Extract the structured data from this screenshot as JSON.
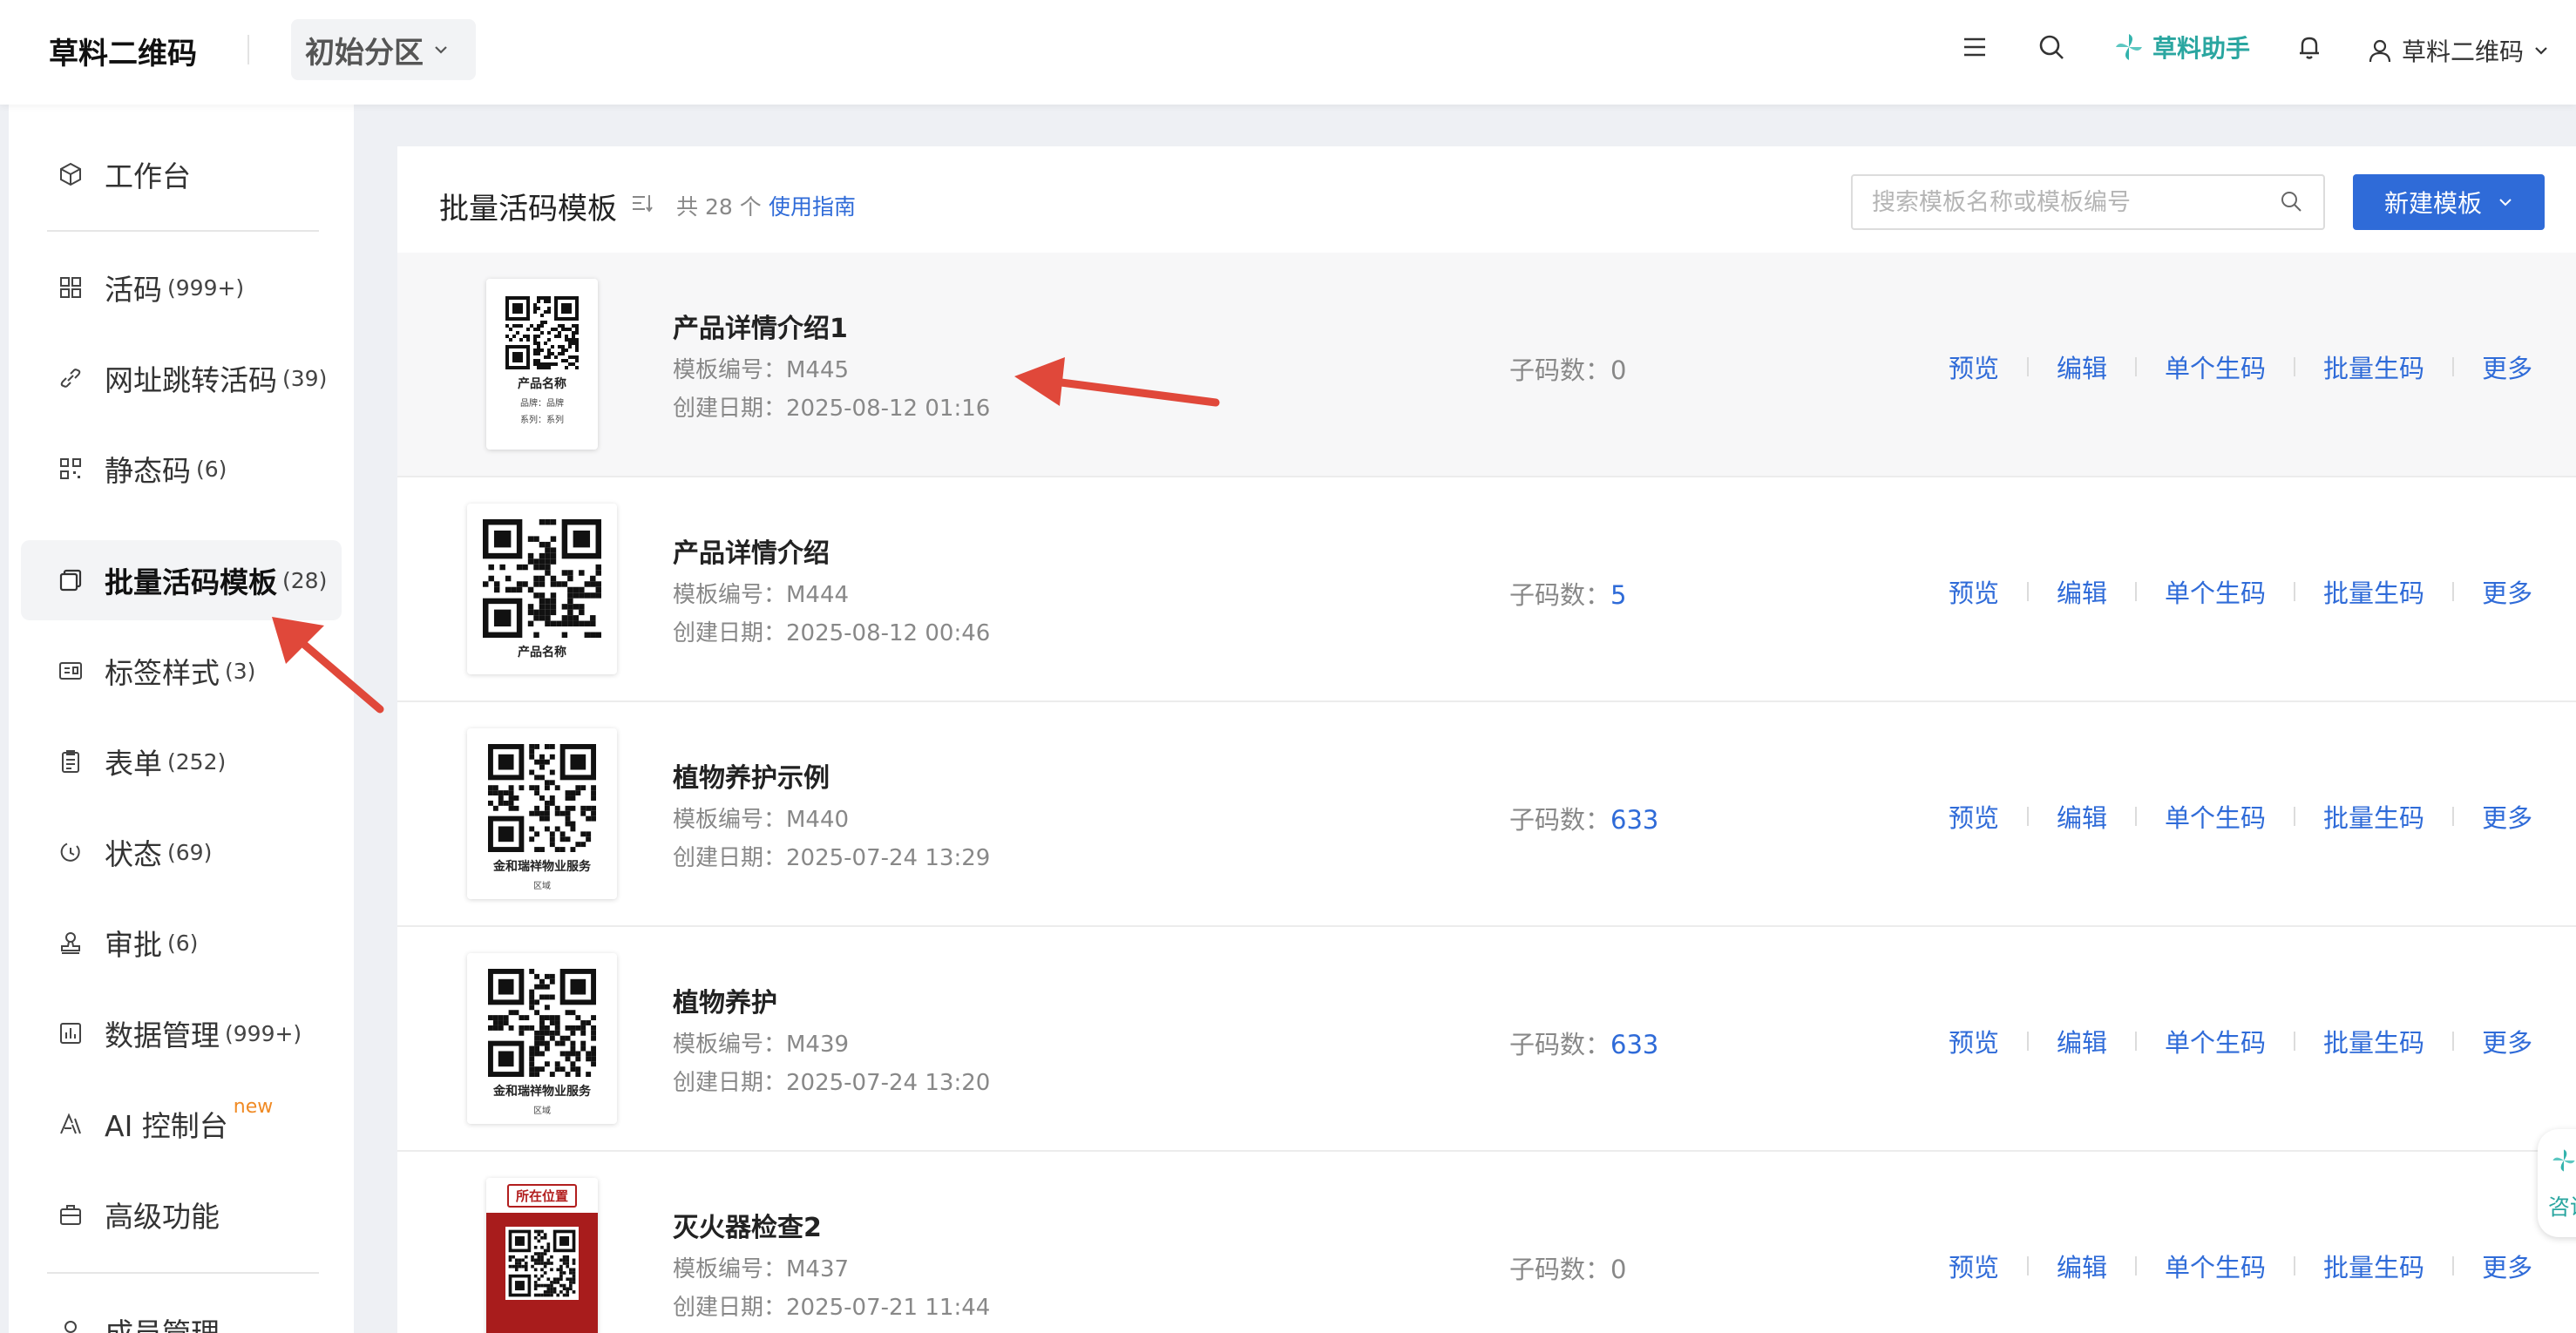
{
  "header": {
    "brand": "草料二维码",
    "zone": "初始分区",
    "helper": "草料助手",
    "user": "草料二维码"
  },
  "sidebar": {
    "items": [
      {
        "label": "工作台",
        "count": "",
        "icon": "cube-icon"
      },
      {
        "label": "活码",
        "count": "(999+)",
        "icon": "grid-icon"
      },
      {
        "label": "网址跳转活码",
        "count": "(39)",
        "icon": "link-icon"
      },
      {
        "label": "静态码",
        "count": "(6)",
        "icon": "qr-small-icon"
      },
      {
        "label": "批量活码模板",
        "count": "(28)",
        "icon": "template-icon",
        "active": true
      },
      {
        "label": "标签样式",
        "count": "(3)",
        "icon": "label-icon"
      },
      {
        "label": "表单",
        "count": "(252)",
        "icon": "clipboard-icon"
      },
      {
        "label": "状态",
        "count": "(69)",
        "icon": "status-icon"
      },
      {
        "label": "审批",
        "count": "(6)",
        "icon": "stamp-icon"
      },
      {
        "label": "数据管理",
        "count": "(999+)",
        "icon": "chart-icon"
      },
      {
        "label": "AI 控制台",
        "badge": "new",
        "icon": "ai-icon"
      },
      {
        "label": "高级功能",
        "count": "",
        "icon": "briefcase-icon"
      },
      {
        "label": "成员管理",
        "count": "",
        "icon": "member-icon"
      }
    ]
  },
  "main": {
    "title": "批量活码模板",
    "total": "共 28 个",
    "guide": "使用指南",
    "search_placeholder": "搜索模板名称或模板编号",
    "new_button": "新建模板",
    "sub_label": "子码数：",
    "actions": [
      "预览",
      "编辑",
      "单个生码",
      "批量生码",
      "更多"
    ],
    "rows": [
      {
        "name": "产品详情介绍1",
        "code": "模板编号：M445",
        "date": "创建日期：2025-08-12 01:16",
        "sub": "0",
        "thumb": {
          "line1": "产品名称",
          "line2": "品牌：品牌",
          "line3": "系列：系列"
        }
      },
      {
        "name": "产品详情介绍",
        "code": "模板编号：M444",
        "date": "创建日期：2025-08-12 00:46",
        "sub": "5",
        "thumb": {
          "line1": "产品名称"
        }
      },
      {
        "name": "植物养护示例",
        "code": "模板编号：M440",
        "date": "创建日期：2025-07-24 13:29",
        "sub": "633",
        "thumb": {
          "line1": "金和瑞祥物业服务",
          "line2": "区域"
        }
      },
      {
        "name": "植物养护",
        "code": "模板编号：M439",
        "date": "创建日期：2025-07-24 13:20",
        "sub": "633",
        "thumb": {
          "line1": "金和瑞祥物业服务",
          "line2": "区域"
        }
      },
      {
        "name": "灭火器检查2",
        "code": "模板编号：M437",
        "date": "创建日期：2025-07-21 11:44",
        "sub": "0",
        "thumb": {
          "line1": "所在位置"
        }
      }
    ]
  },
  "consult": {
    "label": "咨询"
  },
  "colors": {
    "accent": "#2f6bd8",
    "helper": "#2aa6a0",
    "new_badge": "#f08a24",
    "annotation": "#e0483a"
  }
}
